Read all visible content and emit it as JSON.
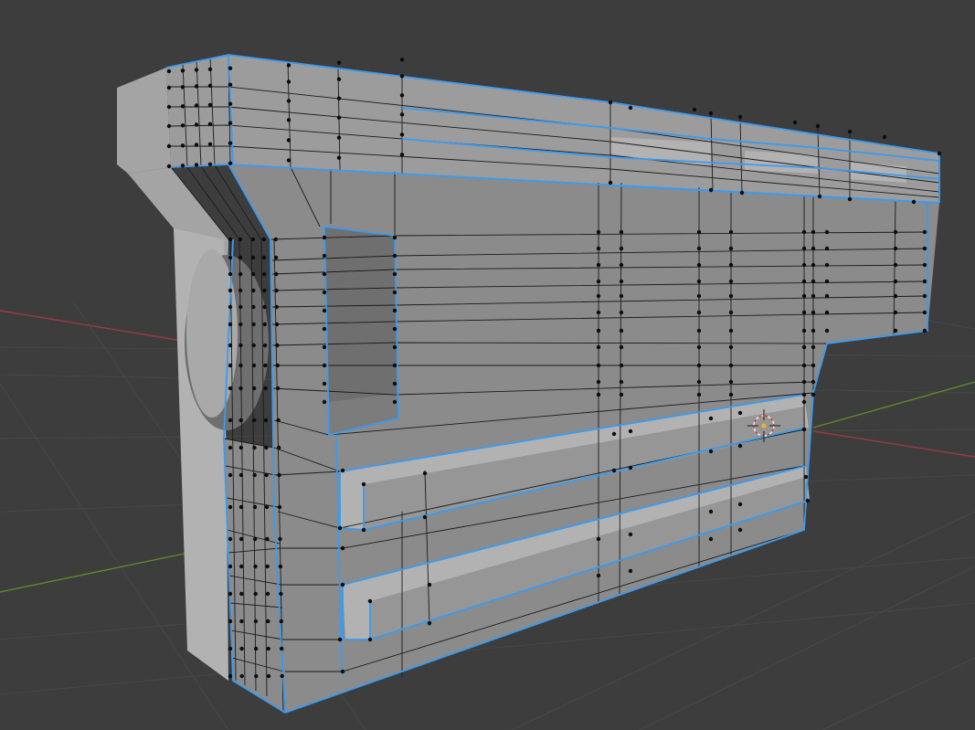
{
  "viewport": {
    "background": "#3d3d3d",
    "grid_color": "#474747",
    "x_axis_color": "#9a3a42",
    "y_axis_color": "#5e8a2a"
  },
  "object": {
    "base_color": "#8b8b8b",
    "edge_color": "#1b1b1b",
    "vertex_color": "#0c0c0c",
    "seam_color": "#3a9bef"
  },
  "cursor": {
    "icon": "3d-cursor-icon",
    "ring_color": "#e8e8e8",
    "dash_color": "#d9473b"
  }
}
